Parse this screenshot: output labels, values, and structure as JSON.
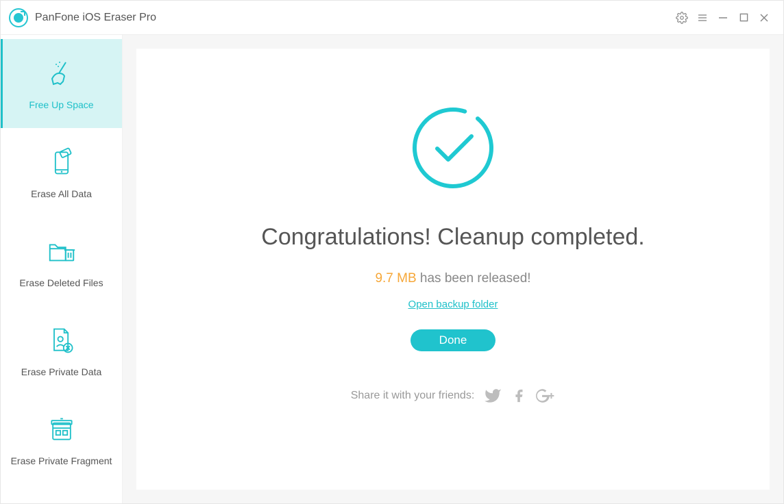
{
  "app": {
    "title": "PanFone iOS Eraser Pro"
  },
  "sidebar": {
    "items": [
      {
        "label": "Free Up Space"
      },
      {
        "label": "Erase All Data"
      },
      {
        "label": "Erase Deleted Files"
      },
      {
        "label": "Erase Private Data"
      },
      {
        "label": "Erase Private Fragment"
      }
    ]
  },
  "main": {
    "heading": "Congratulations! Cleanup completed.",
    "released_size": "9.7 MB",
    "released_suffix": " has been released!",
    "open_backup_link": "Open backup folder",
    "done_label": "Done",
    "share_label": "Share it with your friends:"
  },
  "colors": {
    "accent": "#1fc0c9",
    "accent_bg": "#d6f4f4",
    "orange": "#f6a738"
  }
}
